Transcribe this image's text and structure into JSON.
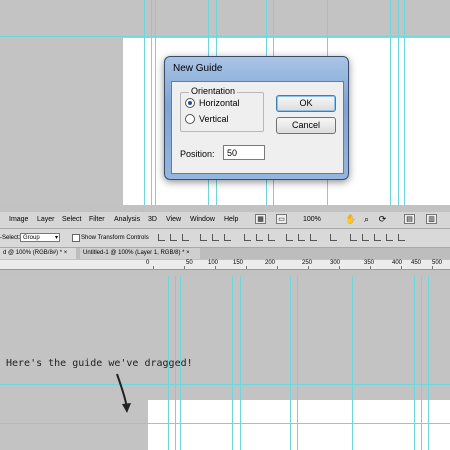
{
  "dialog": {
    "title": "New Guide",
    "orientation_legend": "Orientation",
    "options": [
      "Horizontal",
      "Vertical"
    ],
    "selected_option": "Horizontal",
    "ok_label": "OK",
    "cancel_label": "Cancel",
    "position_label": "Position:",
    "position_value": "50"
  },
  "menu_bar": {
    "items": [
      "Image",
      "Layer",
      "Select",
      "Filter",
      "Analysis",
      "3D",
      "View",
      "Window",
      "Help"
    ],
    "zoom": "100%"
  },
  "options_bar": {
    "auto_select_label": "-Select:",
    "auto_select_value": "Group",
    "show_transform_label": "Show Transform Controls"
  },
  "tabs": [
    {
      "label": "d @ 100% (RGB/8#) *",
      "close": "×"
    },
    {
      "label": "Untitled-1 @ 100% (Layer 1, RGB/8) *",
      "close": "×"
    }
  ],
  "ruler": {
    "labels": [
      "0",
      "50",
      "100",
      "150",
      "200",
      "250",
      "300",
      "350",
      "400",
      "450",
      "500"
    ]
  },
  "annotation": "Here's the guide we've dragged!",
  "colors": {
    "guide": "#6fd6dc",
    "workspace": "#c3c3c3",
    "canvas": "#ffffff",
    "dialog_frame": "#8fb0dc"
  }
}
